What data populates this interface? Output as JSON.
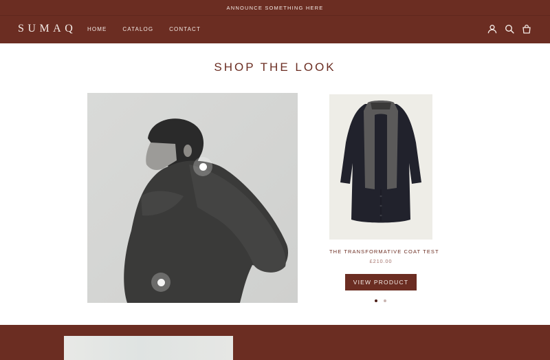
{
  "announcement": {
    "text": "ANNOUNCE SOMETHING HERE"
  },
  "header": {
    "logo": "SUMAQ",
    "nav": [
      {
        "label": "HOME"
      },
      {
        "label": "CATALOG"
      },
      {
        "label": "CONTACT"
      }
    ],
    "icons": [
      "account-icon",
      "search-icon",
      "cart-icon"
    ]
  },
  "shop_the_look": {
    "title": "SHOP THE LOOK",
    "hotspots": [
      "hotspot-1",
      "hotspot-2"
    ],
    "product": {
      "title": "THE TRANSFORMATIVE COAT TEST",
      "price": "£210.00",
      "cta": "VIEW PRODUCT"
    },
    "pagination": {
      "current": 1,
      "total": 2
    }
  },
  "colors": {
    "brand": "#6b2d22",
    "text_light": "#f3e9e4",
    "price": "#a3716a",
    "background": "#ffffff"
  }
}
